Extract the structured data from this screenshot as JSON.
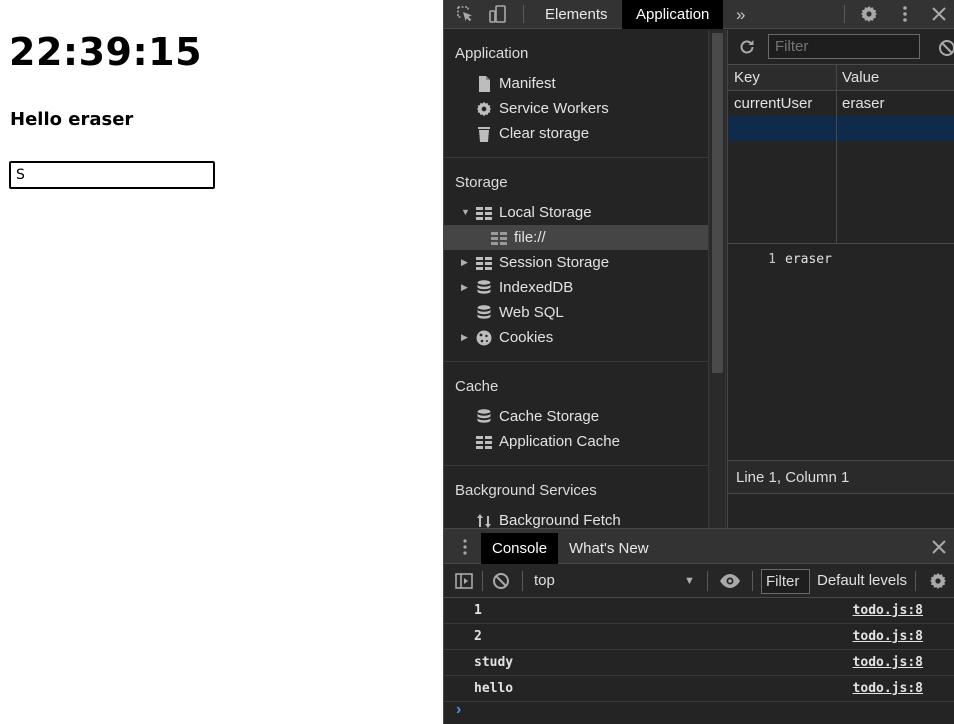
{
  "page": {
    "clock": "22:39:15",
    "greeting": "Hello eraser",
    "input_value": "S"
  },
  "devtools": {
    "tabs": [
      {
        "label": "Elements",
        "active": false
      },
      {
        "label": "Application",
        "active": true
      }
    ],
    "more_tabs": "»",
    "sidebar": {
      "sections": [
        {
          "title": "Application",
          "items": [
            "Manifest",
            "Service Workers",
            "Clear storage"
          ]
        },
        {
          "title": "Storage",
          "items": [
            "Local Storage",
            "file://",
            "Session Storage",
            "IndexedDB",
            "Web SQL",
            "Cookies"
          ]
        },
        {
          "title": "Cache",
          "items": [
            "Cache Storage",
            "Application Cache"
          ]
        },
        {
          "title": "Background Services",
          "items": [
            "Background Fetch"
          ]
        }
      ]
    },
    "storage_view": {
      "filter_placeholder": "Filter",
      "columns": [
        "Key",
        "Value"
      ],
      "rows": [
        {
          "key": "currentUser",
          "value": "eraser"
        }
      ],
      "preview_line_number": "1",
      "preview_value": "eraser",
      "status": "Line 1, Column 1"
    },
    "drawer": {
      "tabs": [
        {
          "label": "Console",
          "active": true
        },
        {
          "label": "What's New",
          "active": false
        }
      ],
      "context": "top",
      "filter_label": "Filter",
      "levels_label": "Default levels",
      "logs": [
        {
          "message": "1",
          "source": "todo.js:8"
        },
        {
          "message": "2",
          "source": "todo.js:8"
        },
        {
          "message": "study",
          "source": "todo.js:8"
        },
        {
          "message": "hello",
          "source": "todo.js:8"
        }
      ],
      "prompt": "›"
    }
  },
  "colors": {
    "devtools_bg": "#242424",
    "toolbar_bg": "#333333",
    "active_tab_bg": "#000000",
    "selected_row": "#0f2a4a",
    "prompt_blue": "#4d8fe6"
  }
}
